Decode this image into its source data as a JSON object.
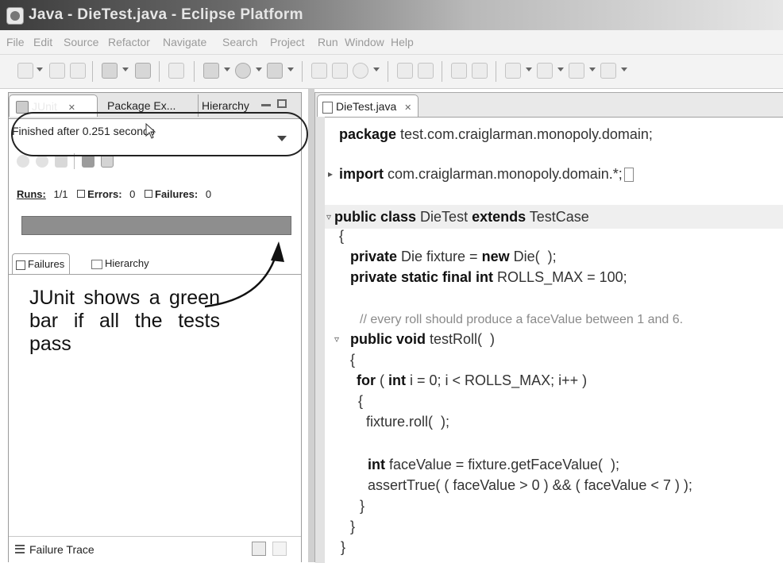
{
  "window": {
    "title": "Java - DieTest.java - Eclipse Platform"
  },
  "menu": [
    "File",
    "Edit",
    "Source",
    "Refactor",
    "Navigate",
    "Search",
    "Project",
    "Run",
    "Window",
    "Help"
  ],
  "left_panel": {
    "tabs": [
      "JUnit",
      "Package Ex...",
      "Hierarchy"
    ],
    "tab_close": "✕",
    "status": "Finished after 0.251 seconds",
    "counters": {
      "runs_label": "Runs:",
      "runs": "1/1",
      "errors_label": "Errors:",
      "errors": "0",
      "failures_label": "Failures:",
      "failures": "0"
    },
    "progress": {
      "value": 1.0,
      "color": "#8e8e8e"
    },
    "sub_tabs": [
      "Failures",
      "Hierarchy"
    ],
    "annotation": "JUnit shows a green bar if all the tests pass",
    "footer_label": "Failure Trace"
  },
  "editor": {
    "tab": "DieTest.java",
    "tab_close": "✕",
    "lines": [
      {
        "kw": "package",
        "rest": " test.com.craiglarman.monopoly.domain;"
      },
      {
        "kw": "import",
        "rest": " com.craiglarman.monopoly.domain.*;"
      },
      {
        "kw": "public class",
        "rest": " DieTest ",
        "kw2": "extends",
        "rest2": " TestCase"
      },
      {
        "rest": "{"
      },
      {
        "kw": "private",
        "rest": " Die fixture = ",
        "kw2": "new",
        "rest2": " Die(  );"
      },
      {
        "kw": "private static final int",
        "rest": " ROLLS_MAX = 100;"
      },
      {
        "comment": "// every roll should produce a faceValue between 1 and 6."
      },
      {
        "kw": "public void",
        "rest": " testRoll(  )"
      },
      {
        "rest": "{"
      },
      {
        "kw": "for",
        "rest": " ( ",
        "kw2": "int",
        "rest2": " i = 0; i < ROLLS_MAX; i++ )"
      },
      {
        "rest": "{"
      },
      {
        "rest": "fixture.roll(  );"
      },
      {
        "kw": "int",
        "rest": " faceValue = fixture.getFaceValue(  );"
      },
      {
        "rest": "assertTrue( ( faceValue > 0 ) && ( faceValue < 7 ) );"
      },
      {
        "rest": "}"
      },
      {
        "rest": "}"
      },
      {
        "rest": "}"
      }
    ]
  }
}
